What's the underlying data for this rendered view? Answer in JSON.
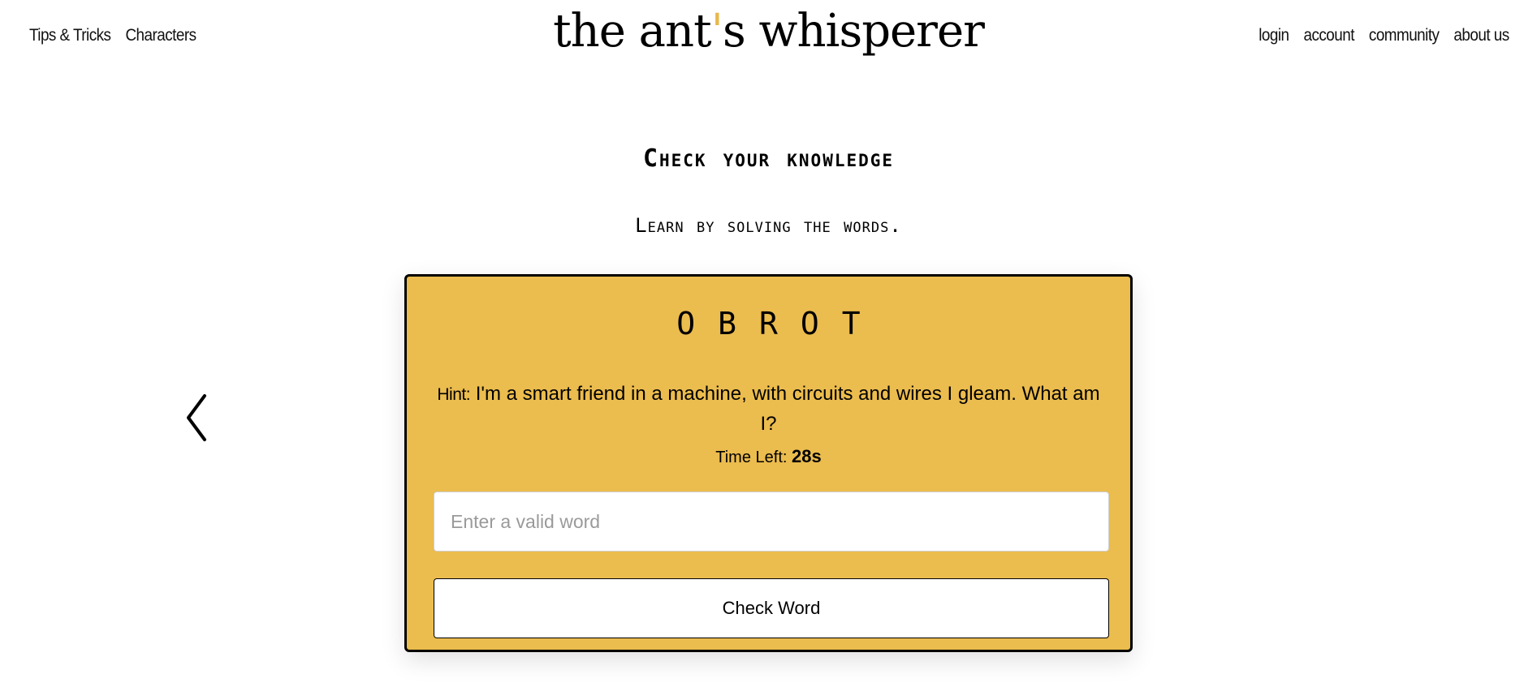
{
  "header": {
    "left_links": [
      "Tips & Tricks",
      "Characters"
    ],
    "title_before": "the ant",
    "title_apostrophe": "'",
    "title_after": "s whisperer",
    "right_links": [
      "login",
      "account",
      "community",
      "about us"
    ]
  },
  "main": {
    "heading": "Check your knowledge",
    "subheading": "Learn by solving the words."
  },
  "game": {
    "scrambled_word": "OBROT",
    "hint_label": "Hint:",
    "hint_text": "I'm a smart friend in a machine, with circuits and wires I gleam. What am I?",
    "time_label": "Time Left:",
    "time_value": "28s",
    "input_placeholder": "Enter a valid word",
    "input_value": "",
    "button_label": "Check Word"
  },
  "colors": {
    "card_background": "#ebbc4e",
    "title_accent": "#e8b84a"
  },
  "icons": {
    "prev": "chevron-left-icon"
  }
}
